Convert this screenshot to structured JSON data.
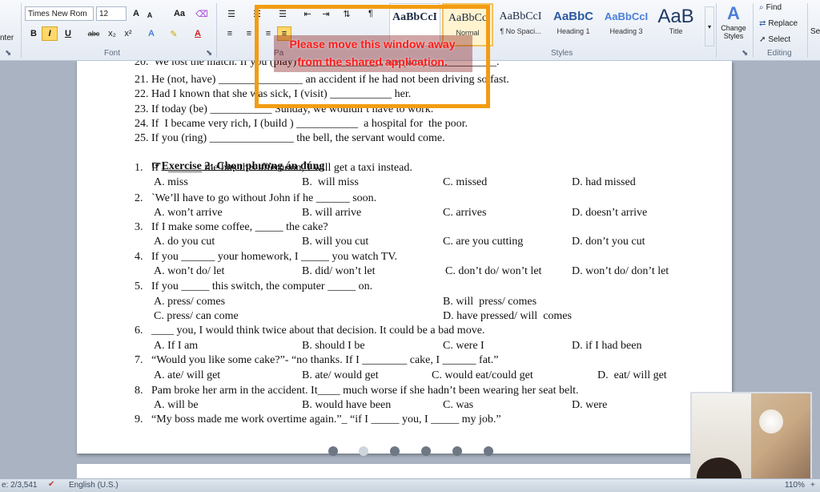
{
  "ribbon": {
    "clipboard_label_partial": "nter",
    "font": {
      "name": "Times New Rom",
      "size": "12",
      "case_label": "Aa",
      "grow_label": "A",
      "shrink_label": "A",
      "bold": "B",
      "italic": "I",
      "underline": "U",
      "strike": "abc",
      "subscript": "x₂",
      "superscript": "x²",
      "group_label": "Font"
    },
    "paragraph": {
      "group_label_partial": "Pa",
      "pilcrow": "¶"
    },
    "styles": {
      "group_label": "Styles",
      "items": [
        {
          "sample": "AaBbCcI",
          "name": ""
        },
        {
          "sample": "AaBbCc",
          "name": "Normal"
        },
        {
          "sample": "AaBbCcI",
          "name": "¶ No Spaci..."
        },
        {
          "sample": "AaBbC",
          "name": "Heading 1"
        },
        {
          "sample": "AaBbCcI",
          "name": "Heading 3"
        },
        {
          "sample": "AaB",
          "name": "Title"
        }
      ],
      "change_label": "Change Styles"
    },
    "editing": {
      "find": "Find",
      "replace": "Replace",
      "select": "Select",
      "group_label": "Editing",
      "partial": "Se"
    }
  },
  "overlay": {
    "message": "Please move this window away\nfrom the shared application."
  },
  "document": {
    "lines": [
      {
        "text": "20.  We lost the match. If you (play) ______________ , we (win) ____________."
      },
      {
        "text": "21. He (not, have) _______________ an accident if he had not been driving so fast."
      },
      {
        "text": "22. Had I known that she was sick, I (visit) ___________ her."
      },
      {
        "text": "23. If today (be) ___________ Sunday, we wouldn’t have to work."
      },
      {
        "text": "24. If  I became very rich, I (build ) ___________  a hospital for  the poor."
      },
      {
        "text": "25. If you (ring) _______________ the bell, the servant would come."
      }
    ],
    "exercise_icon": "☞",
    "exercise_title": "Exercise 2: Chọn phương án đúng",
    "questions": [
      {
        "q": "1.   If I ______ the bus this afternoon, I will get a taxi instead.",
        "a": "A. miss",
        "b": "B.  will miss",
        "c": "C. missed",
        "d": "D. had missed"
      },
      {
        "q": "2.   `We’ll have to go without John if he ______ soon.",
        "a": "A. won’t arrive",
        "b": "B. will arrive",
        "c": "C. arrives",
        "d": "D. doesn’t arrive"
      },
      {
        "q": "3.   If I make some coffee, _____ the cake?",
        "a": "A. do you cut",
        "b": "B. will you cut",
        "c": "C. are you cutting",
        "d": "D. don’t you cut"
      },
      {
        "q": "4.   If you ______ your homework, I _____ you watch TV.",
        "a": "A. won’t do/ let",
        "b": "B. did/ won’t let",
        "c": "C. don’t do/ won’t let",
        "d": "D. won’t do/ don’t let"
      },
      {
        "q": "5.   If you _____ this switch, the computer _____ on.",
        "a": "A. press/ comes",
        "b": "B. will  press/ comes",
        "c": "C. press/ can come",
        "d": "D. have pressed/ will  comes"
      },
      {
        "q": "6.   ____ you, I would think twice about that decision. It could be a bad move.",
        "a": "A. If I am",
        "b": "B. should I be",
        "c": "C. were I",
        "d": "D. if I had been"
      },
      {
        "q": "7.   “Would you like some cake?”- “no thanks. If I ________ cake, I ______ fat.”",
        "a": "A. ate/ will get",
        "b": "B. ate/ would get",
        "c": "C. would eat/could get",
        "d": "D.  eat/ will get"
      },
      {
        "q": "8.   Pam broke her arm in the accident. It____ much worse if she hadn’t been wearing her seat belt.",
        "a": "A. will be",
        "b": "B. would have been",
        "c": "C. was",
        "d": "D. were"
      },
      {
        "q": "9.   “My boss made me work overtime again.”_ “if I _____ you, I _____ my job.”"
      }
    ]
  },
  "status": {
    "page": "e: 2/3,541",
    "language": "English (U.S.)",
    "zoom": "110%"
  },
  "colors": {
    "overlay_border": "#f39c12",
    "overlay_text": "#ff1a1a",
    "doc_background": "#a9b3c1"
  }
}
